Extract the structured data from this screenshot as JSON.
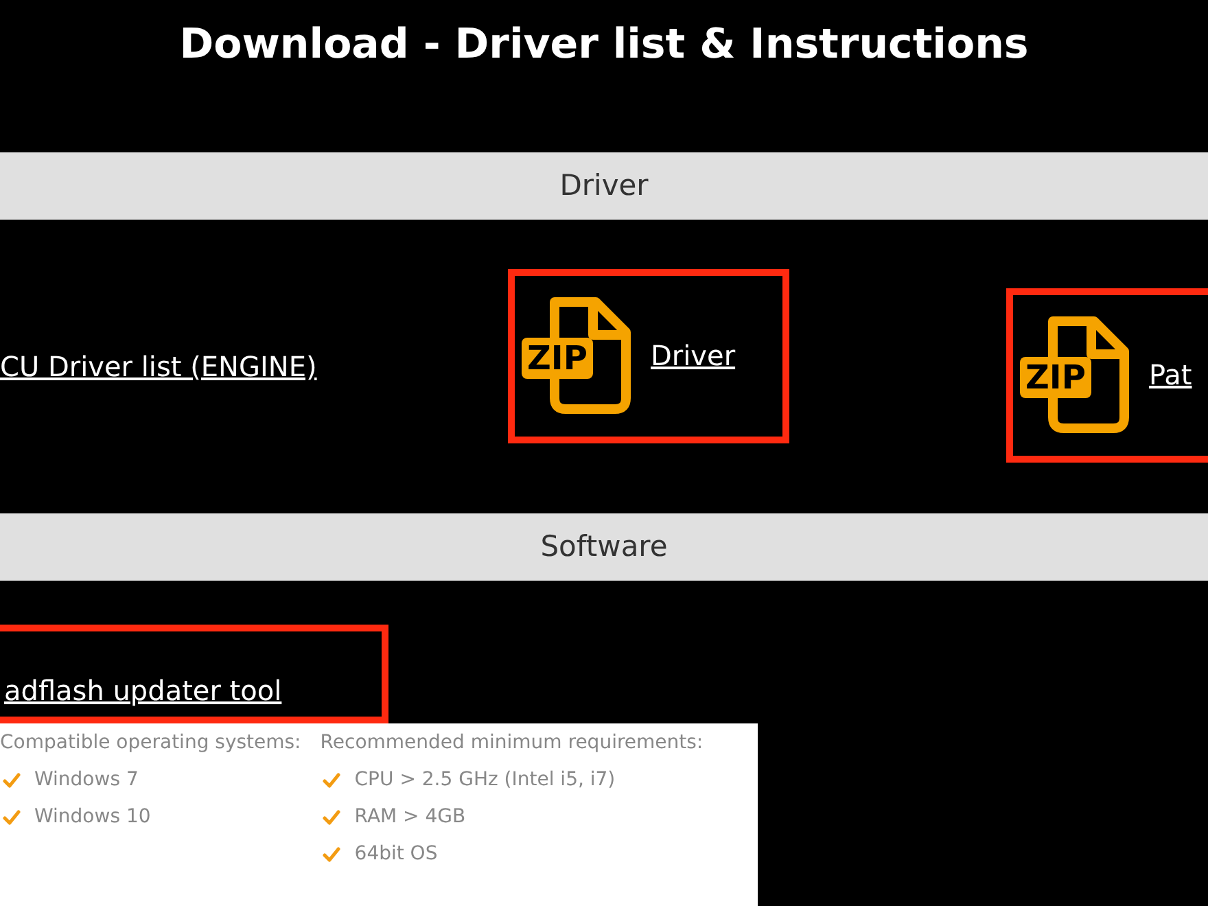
{
  "title": "Download - Driver list & Instructions",
  "driver_section": {
    "heading": "Driver",
    "items": [
      {
        "kind": "link",
        "label": "CU Driver list (ENGINE)",
        "highlighted": false
      },
      {
        "kind": "file",
        "icon_text": "ZIP",
        "label": "Driver",
        "highlighted": true
      },
      {
        "kind": "file",
        "icon_text": "ZIP",
        "label": "Pat",
        "highlighted": true
      }
    ]
  },
  "software_section": {
    "heading": "Software",
    "tool": {
      "label": "adflash updater tool",
      "highlighted": true
    },
    "requirements": [
      {
        "heading": "Compatible operating systems:",
        "items": [
          "Windows 7",
          "Windows 10"
        ]
      },
      {
        "heading": "Recommended minimum requirements:",
        "items": [
          "CPU > 2.5 GHz (Intel i5, i7)",
          "RAM > 4GB",
          "64bit OS"
        ]
      }
    ]
  }
}
